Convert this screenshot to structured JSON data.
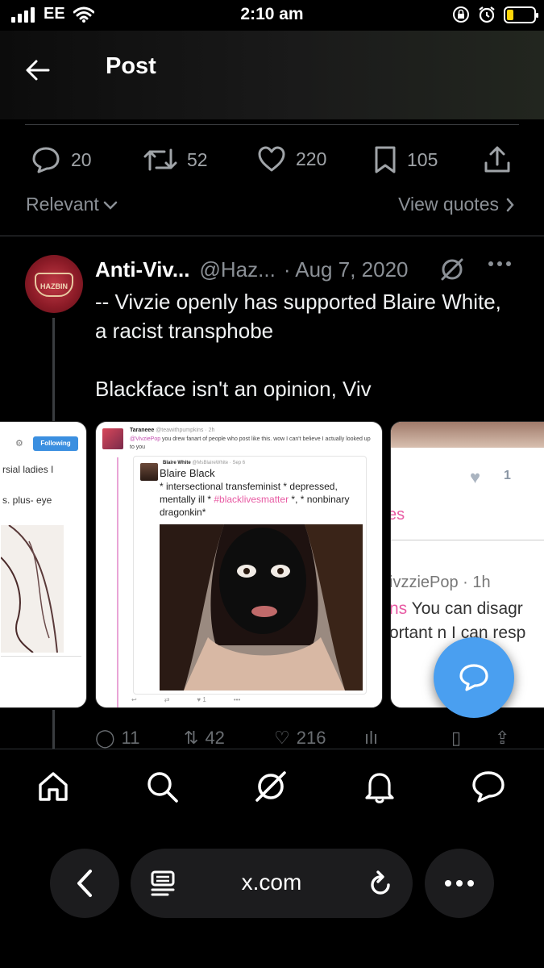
{
  "status_bar": {
    "carrier": "EE",
    "time": "2:10 am",
    "battery_level": 0.25,
    "battery_color": "#ffd60a"
  },
  "header": {
    "title": "Post"
  },
  "stats": {
    "replies": "20",
    "reposts": "52",
    "likes": "220",
    "bookmarks": "105"
  },
  "sort": {
    "relevant_label": "Relevant",
    "view_quotes_label": "View quotes"
  },
  "tweet": {
    "author_name": "Anti-Viv...",
    "author_handle": "@Haz...",
    "date": "· Aug 7, 2020",
    "text_line_1": "-- Vivzie openly has supported Blaire White, a racist transphobe",
    "text_line_2": "Blackface isn't an opinion, Viv",
    "avatar_text": "HAZBIN",
    "actions": {
      "replies": "11",
      "reposts": "42",
      "likes": "216"
    }
  },
  "media": {
    "left_card": {
      "follow_label": "Following",
      "text_1": "rsial ladies I",
      "text_2": "s. plus- eye"
    },
    "mid_card": {
      "poster_name": "Taraneee",
      "poster_handle": "@teawithpumpkins · 2h",
      "reply_mention": "@VivziePop",
      "reply_text": " you drew fanart of people who post like this. wow I can't believe I actually looked up to you",
      "quoted_name": "Blaire White",
      "quoted_handle": "@MsBlaireWhite · Sep 6",
      "quoted_title": "Blaire Black",
      "quoted_body_1": "* intersectional transfeminist * depressed, mentally ill * ",
      "quoted_hashtag": "#blacklivesmatter",
      "quoted_body_2": " *, * nonbinary dragonkin*",
      "like_count": "1"
    },
    "right_card": {
      "like_count": "1",
      "es_text": "es",
      "handle": "ivzziePop · 1h",
      "body_prefix": "ns",
      "body_1": " You can disagr",
      "body_2": "ortant n I can resp"
    }
  },
  "browser": {
    "url": "x.com"
  },
  "colors": {
    "accent": "#4a9ff0",
    "muted": "#8b9096",
    "background": "#000000"
  }
}
